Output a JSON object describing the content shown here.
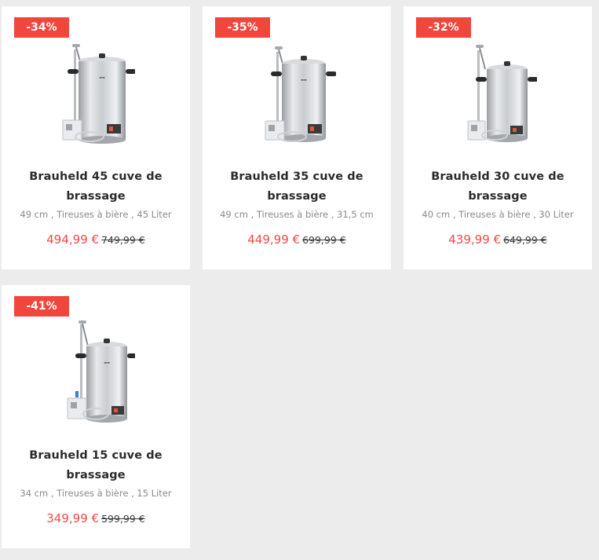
{
  "colors": {
    "background": "#ececec",
    "card": "#ffffff",
    "badge": "#f0463c",
    "sale_price": "#ef4b45",
    "old_price": "#3a3a3a",
    "attributes": "#8a8a8a"
  },
  "products": [
    {
      "discount": "-34%",
      "title": "Brauheld 45 cuve de brassage",
      "attributes": "49 cm , Tireuses à bière , 45 Liter",
      "price": "494,99 €",
      "old_price": "749,99 €",
      "image_icon": "brewing-kettle-image"
    },
    {
      "discount": "-35%",
      "title": "Brauheld 35 cuve de brassage",
      "attributes": "49 cm , Tireuses à bière , 31,5 cm",
      "price": "449,99 €",
      "old_price": "699,99 €",
      "image_icon": "brewing-kettle-image"
    },
    {
      "discount": "-32%",
      "title": "Brauheld 30 cuve de brassage",
      "attributes": "40 cm , Tireuses à bière , 30 Liter",
      "price": "439,99 €",
      "old_price": "649,99 €",
      "image_icon": "brewing-kettle-image"
    },
    {
      "discount": "-41%",
      "title": "Brauheld 15 cuve de brassage",
      "attributes": "34 cm , Tireuses à bière , 15 Liter",
      "price": "349,99 €",
      "old_price": "599,99 €",
      "image_icon": "brewing-kettle-image"
    }
  ]
}
